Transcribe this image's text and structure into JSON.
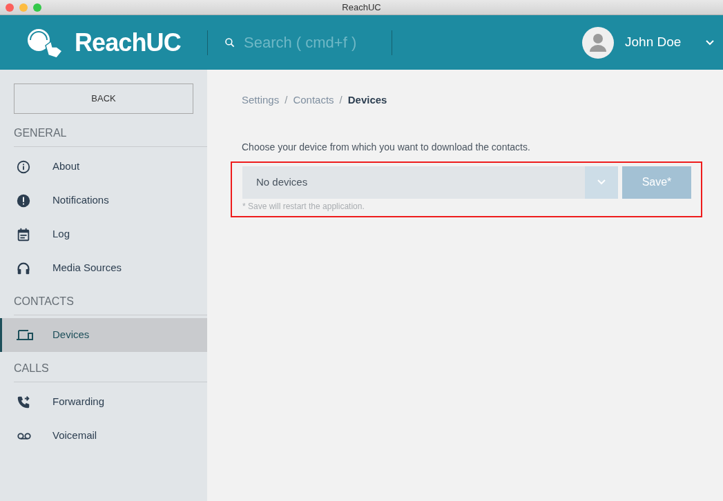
{
  "window": {
    "title": "ReachUC"
  },
  "header": {
    "brand": "ReachUC",
    "search": {
      "placeholder": "Search ( cmd+f )"
    },
    "user": {
      "name": "John Doe"
    }
  },
  "sidebar": {
    "back": "BACK",
    "sections": [
      {
        "title": "GENERAL",
        "items": [
          {
            "label": "About",
            "kind": "info",
            "selected": false
          },
          {
            "label": "Notifications",
            "kind": "alert",
            "selected": false
          },
          {
            "label": "Log",
            "kind": "calendar",
            "selected": false
          },
          {
            "label": "Media Sources",
            "kind": "headset",
            "selected": false
          }
        ]
      },
      {
        "title": "CONTACTS",
        "items": [
          {
            "label": "Devices",
            "kind": "devices",
            "selected": true
          }
        ]
      },
      {
        "title": "CALLS",
        "items": [
          {
            "label": "Forwarding",
            "kind": "forward",
            "selected": false
          },
          {
            "label": "Voicemail",
            "kind": "voicemail",
            "selected": false
          }
        ]
      }
    ]
  },
  "breadcrumb": [
    {
      "label": "Settings",
      "current": false
    },
    {
      "separator": "/",
      "label": "Contacts",
      "current": false
    },
    {
      "separator": "/",
      "label": "Devices",
      "current": true
    }
  ],
  "form": {
    "prompt": "Choose your device from which you want to download the contacts.",
    "select": {
      "value": "No devices"
    },
    "save": {
      "label": "Save*",
      "disabled": true
    },
    "note": "* Save will restart the application.",
    "highlighted": true
  }
}
